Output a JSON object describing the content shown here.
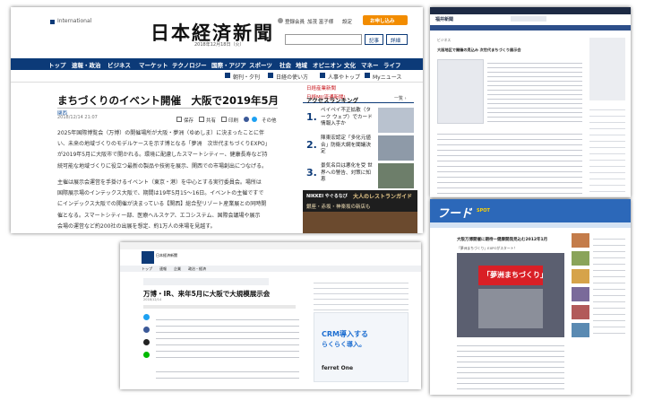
{
  "nikkei": {
    "edition": "International",
    "logo": "日本経済新聞",
    "date": "2018年12月18日（火）",
    "account": {
      "member": "登録会員",
      "name": "加茂 富子様",
      "settings": "設定",
      "app_button": "お申し込み",
      "kiji": "記事",
      "search": "詳細"
    },
    "nav": [
      "トップ",
      "速報・政治",
      "ビジネス",
      "マーケット",
      "テクノロジー",
      "国際・アジア",
      "スポーツ",
      "社会",
      "地域",
      "オピニオン",
      "文化",
      "マネー",
      "ライフ"
    ],
    "subnav": [
      "朝刊・夕刊",
      "日経の使い方",
      "人事やトップ",
      "Myニュース"
    ],
    "article": {
      "title": "まちづくりのイベント開催　大阪で2019年5月",
      "tag": "関西",
      "datetime": "2018/12/14 21:07",
      "actions": [
        "保存",
        "共有",
        "印刷"
      ],
      "more": "その他",
      "para1": [
        "2025年国際博覧会（万博）の開催場所が大阪・夢洲（ゆめしま）に決まったことに伴",
        "い、未来の地域づくりのモデルケースを示す博となる「夢洲　次世代まちづくりEXPO」",
        "が2019年5月に大阪市で開かれる。環境に配慮したスマートシティー、健康長寿など持",
        "続可能な地域づくりに役立つ最新の製品や技術を展示、関西での市場創出につなげる。"
      ],
      "para2": [
        "主催は展示会運営を手掛けるイベント（東京・港）を中心とする実行委員会。場所は",
        "国際展示場のインテックス大阪で、期間は19年5月15～16日。イベントの主催ですで",
        "にインデックス大阪での開催が決まっている【関西】総合型リゾート産業展との同時開",
        "催となる。スマートシティー部、医療ヘルスケア、エコシステム、国際会議場や展示",
        "会場の運営など約200社の出展を想定、約1万人の来場を見越す。"
      ]
    },
    "sidebar": {
      "header_link": "日経産業新聞",
      "header_link2": "日経MJ(流通新聞)",
      "ranking_title": "アクセスランキング",
      "ranking_more": "一覧 ›",
      "items": [
        {
          "rank": "1.",
          "text": "ペイペイ不正拡散（ターク ウェブ）でカード情報入手か"
        },
        {
          "rank": "2.",
          "text": "陳東宏認定「多化元値合」防衛大綱を閣議決定"
        },
        {
          "rank": "3.",
          "text": "景気名目は悪化を受 世界への警告、対策に知恵"
        }
      ],
      "ad_title": "NIKKEI やぐるなび",
      "ad_sub": "大人のレストランガイド",
      "ad_caption": "銀座・赤坂・神楽坂の新店も"
    }
  },
  "right_top": {
    "site": "福井新聞",
    "headline": "大阪地区で開催の見込み 次世代まちづくり展示会",
    "section": "ビジネス"
  },
  "food": {
    "logo": "フード",
    "logo_sub": "SPOT",
    "headline": "大阪万博開催に期待ー健康開発見込む2012年1月",
    "caption": "「夢洲まちづくり」EXPOがスタート！",
    "sign_text": "「夢洲まちづくり」"
  },
  "bottom_center": {
    "logo_text": "日本経済新聞",
    "tabs": [
      "トップ",
      "速報",
      "企業",
      "政治・経済"
    ],
    "headline": "万博・IR、来年5月に大阪で大規模展示会",
    "date": "2018/12/14",
    "ad_big": "CRM導入する",
    "ad_small": "らくらく導入。",
    "ad_brand": "ferret One"
  },
  "colors": {
    "navy": "#0c3a78",
    "orange": "#f28c00",
    "red": "#c8161d",
    "link_blue": "#1a56a0"
  }
}
